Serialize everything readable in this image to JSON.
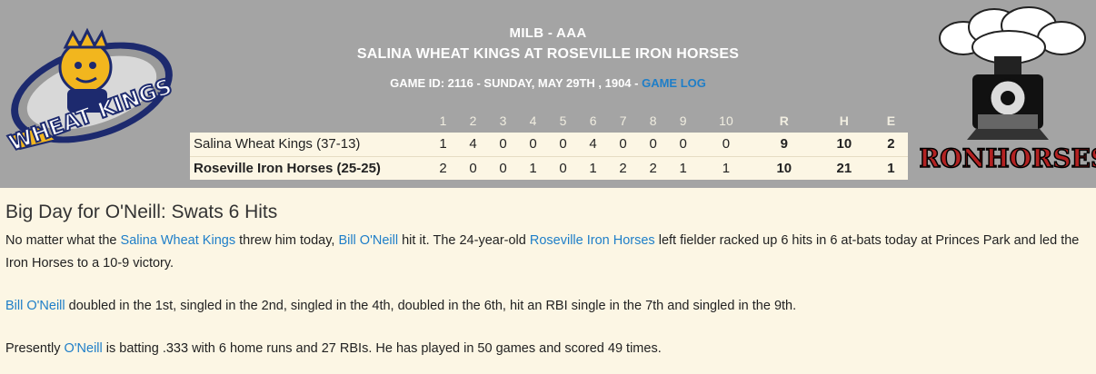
{
  "header": {
    "league": "MILB - AAA",
    "matchup": "SALINA WHEAT KINGS AT ROSEVILLE IRON HORSES",
    "game_info": "GAME ID: 2116 - SUNDAY, MAY 29TH , 1904 - ",
    "game_log_link": "GAME LOG"
  },
  "logos": {
    "left": {
      "name": "Wheat Kings",
      "text": "WHEAT KINGS",
      "colors": [
        "#f2b61e",
        "#1d2a6e",
        "#8a8a8a"
      ]
    },
    "right": {
      "name": "Iron Horses",
      "text": "IRONHORSES",
      "colors": [
        "#000000",
        "#b22222",
        "#ffffff"
      ]
    }
  },
  "linescore": {
    "headers": [
      "1",
      "2",
      "3",
      "4",
      "5",
      "6",
      "7",
      "8",
      "9",
      "10",
      "R",
      "H",
      "E"
    ],
    "rows": [
      {
        "team": "Salina Wheat Kings (37-13)",
        "innings": [
          "1",
          "4",
          "0",
          "0",
          "0",
          "4",
          "0",
          "0",
          "0",
          "0"
        ],
        "r": "9",
        "h": "10",
        "e": "2"
      },
      {
        "team": "Roseville Iron Horses (25-25)",
        "innings": [
          "2",
          "0",
          "0",
          "1",
          "0",
          "1",
          "2",
          "2",
          "1",
          "1"
        ],
        "r": "10",
        "h": "21",
        "e": "1"
      }
    ]
  },
  "article": {
    "title": "Big Day for O'Neill: Swats 6 Hits",
    "p1": {
      "t1": "No matter what the ",
      "l1": "Salina Wheat Kings",
      "t2": " threw him today, ",
      "l2": "Bill O'Neill",
      "t3": " hit it. The 24-year-old ",
      "l3": "Roseville Iron Horses",
      "t4": " left fielder racked up 6 hits in 6 at-bats today at Princes Park and led the Iron Horses to a 10-9 victory."
    },
    "p2": {
      "l1": "Bill O'Neill",
      "t1": " doubled in the 1st, singled in the 2nd, singled in the 4th, doubled in the 6th, hit an RBI single in the 7th and singled in the 9th."
    },
    "p3": {
      "t1": "Presently ",
      "l1": "O'Neill",
      "t2": " is batting .333 with 6 home runs and 27 RBIs. He has played in 50 games and scored 49 times."
    }
  }
}
